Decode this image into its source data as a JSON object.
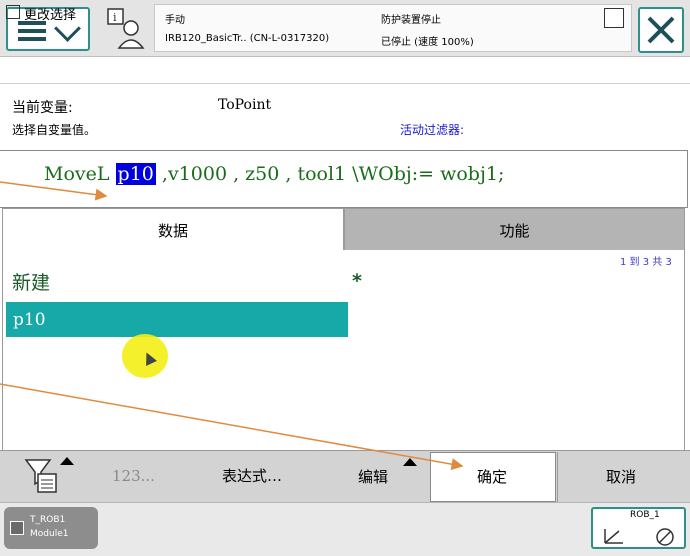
{
  "header": {
    "mode": "手动",
    "system": "IRB120_BasicTr.. (CN-L-0317320)",
    "guard": "防护装置停止",
    "state": "已停止 (速度 100%)"
  },
  "subheader": {
    "title": "更改选择"
  },
  "info": {
    "current_var_label": "当前变量:",
    "current_var_value": "ToPoint",
    "pick_label": "选择自变量值。",
    "filter_label": "活动过滤器:"
  },
  "instruction": {
    "before": "MoveL ",
    "selected": "p10",
    "after": " ,v1000 , z50 , tool1 \\WObj:= wobj1;"
  },
  "tabs": [
    {
      "label": "数据"
    },
    {
      "label": "功能"
    }
  ],
  "list": {
    "page_count": "1 到 3 共 3",
    "new_label": "新建",
    "star": "*",
    "items": [
      {
        "label": "p10",
        "selected": true
      }
    ]
  },
  "toolbar": {
    "number_label": "123...",
    "expression_label": "表达式…",
    "edit_label": "编辑",
    "ok_label": "确定",
    "cancel_label": "取消"
  },
  "taskbar": {
    "task_line1": "T_ROB1",
    "task_line2": "Module1",
    "robot_label": "ROB_1"
  },
  "colors": {
    "accent": "#2f8f8a",
    "selection": "#17a8a8",
    "instruction_text": "#1a6b1a",
    "arrow": "#e08a3c"
  }
}
